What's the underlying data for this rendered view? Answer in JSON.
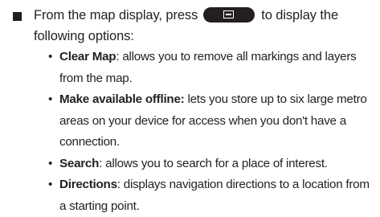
{
  "intro": {
    "before_key": "From the map display, press",
    "after_key": "to display the following options:",
    "key_icon": "menu-key-icon"
  },
  "options": [
    {
      "term": "Clear Map",
      "separator": ":",
      "description": "allows you to remove all markings and layers from the map."
    },
    {
      "term": "Make available offline:",
      "separator": "",
      "description": "lets you store up to six large metro areas on your device for access when you don't have a connection."
    },
    {
      "term": "Search",
      "separator": ":",
      "description": "allows you to search for a place of interest."
    },
    {
      "term": "Directions",
      "separator": ":",
      "description": "displays navigation directions to a location from a starting point."
    }
  ],
  "bullet_glyph": "•"
}
